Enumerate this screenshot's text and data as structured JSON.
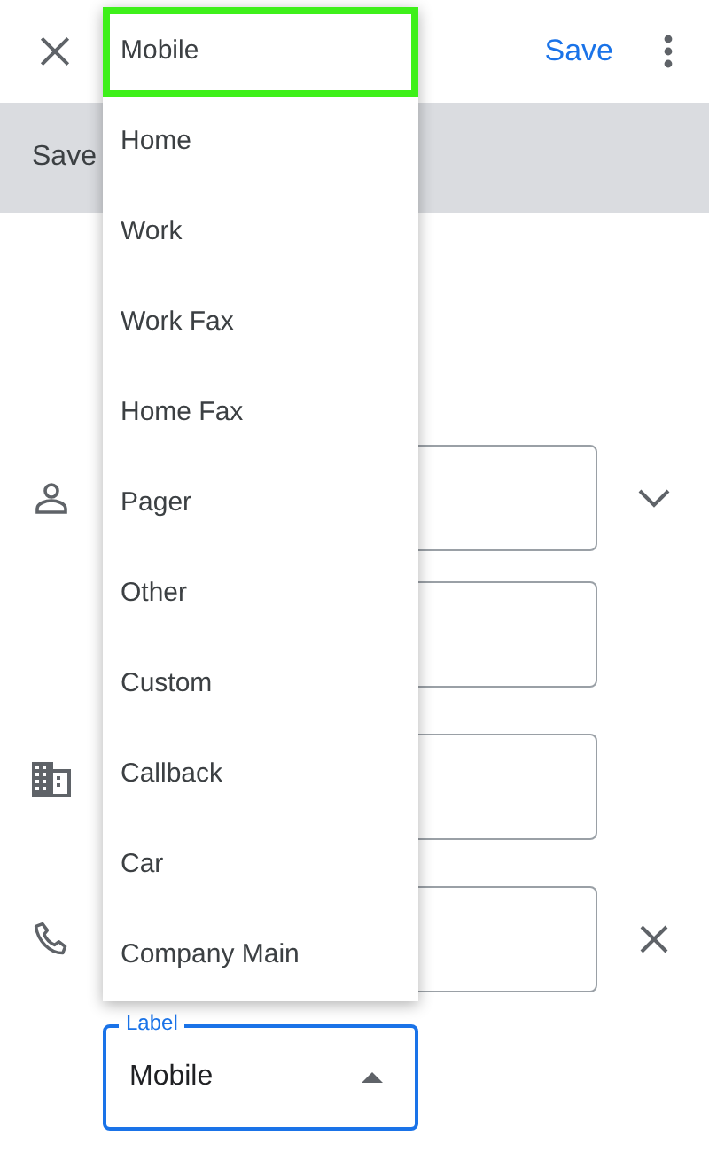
{
  "top_bar": {
    "save": "Save"
  },
  "banner": {
    "text": "Save"
  },
  "label_field": {
    "label": "Label",
    "value": "Mobile",
    "expanded": true
  },
  "menu": {
    "items": [
      {
        "label": "Mobile",
        "selected": true
      },
      {
        "label": "Home",
        "selected": false
      },
      {
        "label": "Work",
        "selected": false
      },
      {
        "label": "Work Fax",
        "selected": false
      },
      {
        "label": "Home Fax",
        "selected": false
      },
      {
        "label": "Pager",
        "selected": false
      },
      {
        "label": "Other",
        "selected": false
      },
      {
        "label": "Custom",
        "selected": false
      },
      {
        "label": "Callback",
        "selected": false
      },
      {
        "label": "Car",
        "selected": false
      },
      {
        "label": "Company Main",
        "selected": false
      }
    ]
  }
}
